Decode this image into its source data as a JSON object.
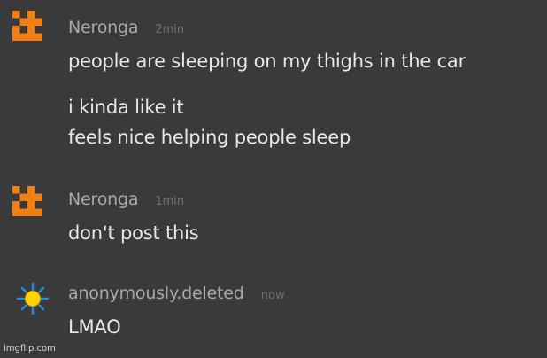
{
  "messages": [
    {
      "username": "Neronga",
      "timestamp": "2min",
      "avatar_icon": "neronga-pixel-avatar-icon",
      "lines": [
        "people are sleeping on my thighs in the car",
        "i kinda like it",
        "feels nice helping people sleep"
      ]
    },
    {
      "username": "Neronga",
      "timestamp": "1min",
      "avatar_icon": "neronga-pixel-avatar-icon",
      "lines": [
        "don't post this"
      ]
    },
    {
      "username": "anonymously.deleted",
      "timestamp": "now",
      "avatar_icon": "sun-avatar-icon",
      "lines": [
        "LMAO"
      ]
    }
  ],
  "watermark": "imgflip.com",
  "colors": {
    "background": "#3a3a3a",
    "username": "#a9a9a9",
    "timestamp": "#707070",
    "message_text": "#e8e8e8",
    "neronga_avatar": "#f07f16",
    "sun_avatar_core": "#ffd400",
    "sun_avatar_rays": "#1e90e0"
  }
}
